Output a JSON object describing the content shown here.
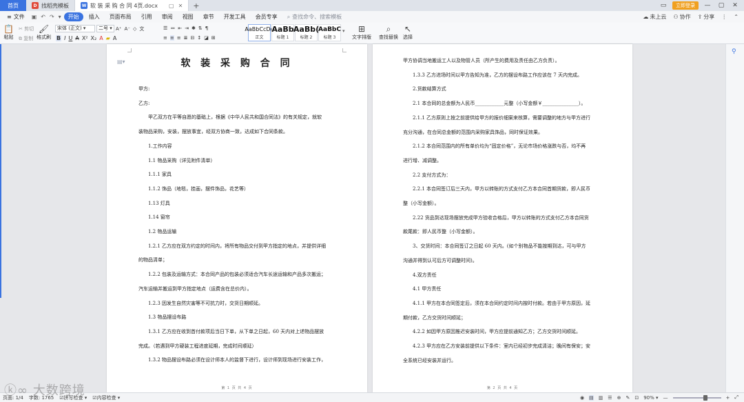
{
  "tabbar": {
    "home": "首页",
    "tab1": "找稻壳模板",
    "tab2": "软 装 采 购 合 同  4页.docx",
    "plus": "+",
    "login": "立即登录"
  },
  "menubar": {
    "file": "文件",
    "items": [
      "开始",
      "插入",
      "页面布局",
      "引用",
      "审阅",
      "视图",
      "章节",
      "开发工具",
      "会员专享"
    ],
    "search": "查找命令、搜索模板",
    "right": [
      "未上云",
      "协作",
      "分享"
    ]
  },
  "ribbon": {
    "paste": "粘贴",
    "cut": "剪切",
    "copy": "复制",
    "format_painter": "格式刷",
    "font_name": "宋体 (正文)",
    "font_size": "二号",
    "styles": [
      {
        "sample": "AaBbCcDd",
        "label": "正文"
      },
      {
        "sample": "AaBb",
        "label": "标题 1"
      },
      {
        "sample": "AaBb(",
        "label": "标题 2"
      },
      {
        "sample": "AaBbC",
        "label": "标题 3"
      }
    ],
    "text_layout": "文字排版",
    "find_replace": "查找替换",
    "select": "选择"
  },
  "page1": {
    "title": "软 装 采 购 合 同",
    "lines": [
      {
        "t": "甲方:",
        "indent": 0
      },
      {
        "t": "乙方:",
        "indent": 0
      },
      {
        "t": "甲乙双方在平等自愿的基础上，根据《中华人民共和国合同法》的有关规定，就软",
        "indent": 1
      },
      {
        "t": "装物品采购，安装，摆放事宜，经双方协商一致，达成如下合同条款。",
        "indent": 0
      },
      {
        "t": "1.工作内容",
        "indent": 1
      },
      {
        "t": "1.1 物品采购（详见附件清单）",
        "indent": 1
      },
      {
        "t": "1.1.1 家具",
        "indent": 1
      },
      {
        "t": "1.1.2 饰品（地毯，挂画，摆件饰品，花艺等）",
        "indent": 1
      },
      {
        "t": "1.13 灯具",
        "indent": 1
      },
      {
        "t": "1.14 窗帘",
        "indent": 1
      },
      {
        "t": "1.2 物品运输",
        "indent": 1
      },
      {
        "t": "1.2.1 乙方应在双方约定的时间内，将所有物品交付到甲方指定的地点，并提供详细",
        "indent": 1
      },
      {
        "t": "的物品清单；",
        "indent": 0
      },
      {
        "t": "1.2.2 包装及运输方式：本合同产品的包装必须适合汽车长途运输和产品多次搬运；",
        "indent": 1
      },
      {
        "t": "汽车运输并搬运到甲方指定地点（运费含在总价内）。",
        "indent": 0
      },
      {
        "t": "1.2.3 因发生自然灾害等不可抗力时，交货日期顺延。",
        "indent": 1
      },
      {
        "t": "1.3 物品摆设布路",
        "indent": 1
      },
      {
        "t": "1.3.1 乙方应在收到首付款项后当日下单，从下单之日起，60 天内对上述物品摆放",
        "indent": 1
      },
      {
        "t": "完成。（若遇到甲方硬装工程进度延期，完成时间顺延）",
        "indent": 0
      },
      {
        "t": "1.3.2 物品摆设布路必须在设计师本人的监督下进行，设计师到现场进行安装工作，",
        "indent": 1
      }
    ],
    "footer": "第 1 页 共 4 页"
  },
  "page2": {
    "lines": [
      {
        "t": "甲方协调当地搬运工人以及物管人员（所产生的费用及责任由乙方负责）。",
        "indent": 0
      },
      {
        "t": "1.3.3 乙方进场时间以甲方告知为准，乙方的摆设布路工作应该在 7 天内完成。",
        "indent": 1
      },
      {
        "t": "2.货款结算方式",
        "indent": 1
      },
      {
        "t": "2.1 本合同的总金额为人民币____________元整（小写金额￥_______________）。",
        "indent": 1
      },
      {
        "t": "2.1.1 乙方原则上按之前提供给甲方的报价细案来核算，需要调整的地方与甲方进行",
        "indent": 1
      },
      {
        "t": "充分沟通，在合同总金额的范围内采购家具饰品，同时保证效果。",
        "indent": 0
      },
      {
        "t": "2.1.2 本合同范围内的所有单价均为“固定价格”，无论市场价格涨跌与否，均不再",
        "indent": 1
      },
      {
        "t": "进行增、减调整。",
        "indent": 0
      },
      {
        "t": "2.2 支付方式为：",
        "indent": 1
      },
      {
        "t": "2.2.1 本合同签订后三天内，甲方以转账的方式支付乙方本合同首期货款，即人民币",
        "indent": 1
      },
      {
        "t": "整（小写金额）。",
        "indent": 0
      },
      {
        "t": "2.22 货品到达现场摆放完成甲方验收合格后，甲方以转账的方式支付乙方本合同货",
        "indent": 1
      },
      {
        "t": "款尾款：即人民币整（小写金额）。",
        "indent": 0
      },
      {
        "t": "3、交货时间：本合同签订之日起 60 天内。(如个别物品不能按期到达，可与甲方",
        "indent": 1
      },
      {
        "t": "沟通并得到认可后方可调整时间)。",
        "indent": 0
      },
      {
        "t": "4.双方责任",
        "indent": 1
      },
      {
        "t": "4.1 甲方责任",
        "indent": 1
      },
      {
        "t": "4.1.1 甲方在本合同签定后，须在本合同约定时间内按时付款。若由于甲方原因，延",
        "indent": 1
      },
      {
        "t": "期付款，乙方交货时间顺延；",
        "indent": 0
      },
      {
        "t": "4.2.2 如因甲方原因推迟安装时间，甲方应提前通知乙方；乙方交货时间顺延。",
        "indent": 1
      },
      {
        "t": "4.2.3 甲方应在乙方安装前提供以下条件：室内已经初步完成清洁；晚间有保安；安",
        "indent": 1
      },
      {
        "t": "全系统已经安装并运行。",
        "indent": 0
      }
    ],
    "footer": "第 2 页 共 4 页"
  },
  "statusbar": {
    "page": "页面: 1/4",
    "words": "字数: 1765",
    "spell": "拼写检查",
    "content_check": "内容检查",
    "zoom": "90%"
  },
  "watermark": "大数跨境",
  "colors": {
    "accent": "#3a73e0",
    "login": "#f0a020"
  }
}
